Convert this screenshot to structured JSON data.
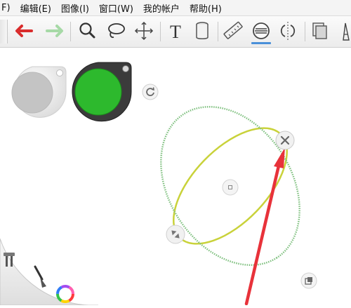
{
  "menu": {
    "items": [
      "F)",
      "编辑(E)",
      "图像(I)",
      "窗口(W)",
      "我的帐户",
      "帮助(H)"
    ]
  },
  "toolbar": {
    "tools": [
      {
        "name": "undo",
        "icon": "undo-arrow-icon"
      },
      {
        "name": "redo",
        "icon": "redo-arrow-icon"
      },
      {
        "name": "zoom",
        "icon": "magnifier-icon"
      },
      {
        "name": "lasso",
        "icon": "lasso-icon"
      },
      {
        "name": "move",
        "icon": "move-arrows-icon"
      },
      {
        "name": "text",
        "icon": "text-T-icon",
        "glyph": "T"
      },
      {
        "name": "fill",
        "icon": "paint-bucket-icon"
      },
      {
        "name": "ruler",
        "icon": "ruler-icon"
      },
      {
        "name": "ellipse-guide",
        "icon": "ellipse-guide-icon",
        "active": true
      },
      {
        "name": "symmetry",
        "icon": "symmetry-icon"
      },
      {
        "name": "layers",
        "icon": "layers-icon"
      },
      {
        "name": "brush",
        "icon": "brush-tip-icon"
      }
    ],
    "active_color": "#4a90d9"
  },
  "colors": {
    "primary_swatch": "#2db92d",
    "secondary_swatch": "#c4c4c4",
    "ellipse_green": "#7fc07f",
    "ellipse_yellow": "#c9d23a",
    "annotation_arrow": "#e8323a"
  }
}
